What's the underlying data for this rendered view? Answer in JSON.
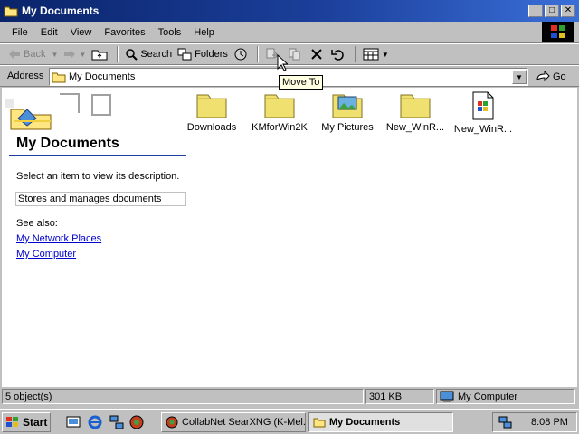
{
  "window": {
    "title": "My Documents"
  },
  "menu": [
    "File",
    "Edit",
    "View",
    "Favorites",
    "Tools",
    "Help"
  ],
  "toolbar": {
    "back": "Back",
    "search": "Search",
    "folders": "Folders"
  },
  "address": {
    "label": "Address",
    "value": "My Documents",
    "go": "Go"
  },
  "tooltip": "Move To",
  "sidepanel": {
    "title": "My Documents",
    "select_text": "Select an item to view its description.",
    "description": "Stores and manages documents",
    "see_also": "See also:",
    "links": [
      "My Network Places",
      "My Computer"
    ]
  },
  "files": [
    {
      "name": "Downloads",
      "icon": "folder-icon"
    },
    {
      "name": "KMforWin2K",
      "icon": "folder-icon"
    },
    {
      "name": "My Pictures",
      "icon": "pictures-folder-icon"
    },
    {
      "name": "New_WinR...",
      "icon": "folder-icon"
    },
    {
      "name": "New_WinR...",
      "icon": "media-file-icon"
    }
  ],
  "status": {
    "objects": "5 object(s)",
    "size": "301 KB",
    "zone": "My Computer"
  },
  "taskbar": {
    "start": "Start",
    "tasks": [
      "CollabNet SearXNG (K-Mel...",
      "My Documents"
    ],
    "clock": "8:08 PM"
  },
  "colors": {
    "title_bar": "#0a246a",
    "link": "#0000cc",
    "face": "#c0c0c0"
  }
}
